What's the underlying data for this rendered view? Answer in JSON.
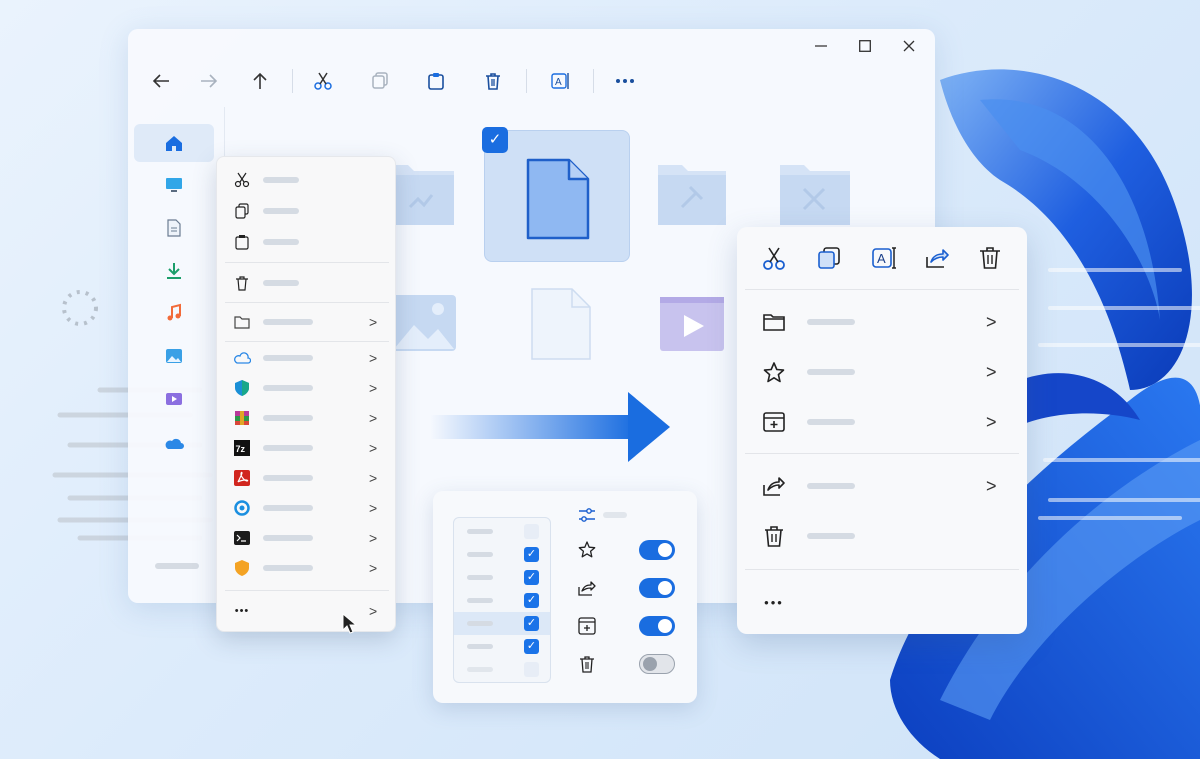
{
  "window": {
    "toolbar": [
      {
        "name": "back",
        "icon": "arrow-left-icon"
      },
      {
        "name": "forward",
        "icon": "arrow-right-icon"
      },
      {
        "name": "up",
        "icon": "arrow-up-icon"
      },
      {
        "name": "cut",
        "icon": "scissors-icon"
      },
      {
        "name": "copy",
        "icon": "copy-icon"
      },
      {
        "name": "paste",
        "icon": "clipboard-icon"
      },
      {
        "name": "delete",
        "icon": "trash-icon"
      },
      {
        "name": "rename",
        "icon": "rename-icon"
      },
      {
        "name": "more",
        "icon": "more-icon"
      }
    ],
    "window_controls": {
      "minimize": "—",
      "maximize": "☐",
      "close": "✕"
    },
    "sidebar": [
      "home-icon",
      "desktop-icon",
      "documents-icon",
      "downloads-icon",
      "music-icon",
      "pictures-icon",
      "videos-icon",
      "onedrive-icon"
    ],
    "files": [
      "folder-documents",
      "file-selected",
      "folder-pinned",
      "folder-tools",
      "image",
      "file",
      "video"
    ]
  },
  "legacy_context_menu": {
    "more_label": "•••",
    "items": [
      "cut-icon",
      "copy-icon",
      "paste-icon",
      "delete-icon",
      "folder-icon",
      "onedrive-icon",
      "defender-icon",
      "winrar-icon",
      "7zip-icon",
      "pdf-icon",
      "app-icon",
      "terminal-icon",
      "shield-icon"
    ],
    "seven_zip_label": "7z"
  },
  "new_context_menu": {
    "more_label": "•••",
    "rows": [
      "folder-icon",
      "star-icon",
      "new-item-icon",
      "share-icon",
      "trash-icon"
    ]
  },
  "settings_panel": {
    "toggles": [
      {
        "icon": "star-icon",
        "on": true
      },
      {
        "icon": "share-icon",
        "on": true
      },
      {
        "icon": "new-item-icon",
        "on": true
      },
      {
        "icon": "trash-icon",
        "on": false
      }
    ],
    "list_checks": [
      false,
      true,
      true,
      true,
      true,
      true,
      false
    ]
  },
  "colors": {
    "accent": "#1a73e8",
    "background": "#dcebfb"
  }
}
